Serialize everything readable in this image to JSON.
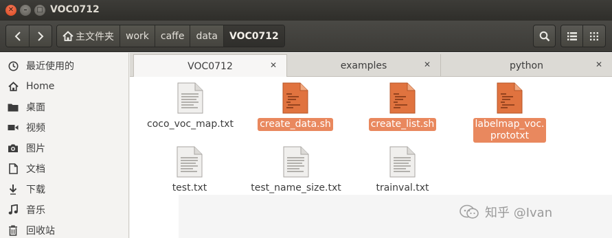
{
  "window": {
    "title": "VOC0712"
  },
  "toolbar": {
    "back_icon": "chevron-left-icon",
    "forward_icon": "chevron-right-icon",
    "breadcrumbs": [
      "主文件夹",
      "work",
      "caffe",
      "data",
      "VOC0712"
    ]
  },
  "sidebar": {
    "items": [
      {
        "label": "最近使用的",
        "icon": "clock-icon"
      },
      {
        "label": "Home",
        "icon": "home-icon"
      },
      {
        "label": "桌面",
        "icon": "folder-icon"
      },
      {
        "label": "视频",
        "icon": "video-icon"
      },
      {
        "label": "图片",
        "icon": "camera-icon"
      },
      {
        "label": "文档",
        "icon": "document-icon"
      },
      {
        "label": "下载",
        "icon": "download-icon"
      },
      {
        "label": "音乐",
        "icon": "music-icon"
      },
      {
        "label": "回收站",
        "icon": "trash-icon"
      }
    ]
  },
  "tabs": [
    {
      "label": "VOC0712",
      "active": true
    },
    {
      "label": "examples",
      "active": false
    },
    {
      "label": "python",
      "active": false
    }
  ],
  "files": [
    {
      "name": "coco_voc_map.txt",
      "type": "text",
      "selected": false
    },
    {
      "name": "create_data.sh",
      "type": "script",
      "selected": true
    },
    {
      "name": "create_list.sh",
      "type": "script",
      "selected": true
    },
    {
      "name_line1": "labelmap_voc.",
      "name_line2": "prototxt",
      "type": "script",
      "selected": true
    },
    {
      "name": "test.txt",
      "type": "text",
      "selected": false
    },
    {
      "name": "test_name_size.txt",
      "type": "text",
      "selected": false
    },
    {
      "name": "trainval.txt",
      "type": "text",
      "selected": false
    }
  ],
  "watermark": {
    "text": "知乎 @Ivan"
  },
  "colors": {
    "selection": "#e9885e",
    "script_icon": "#e0733f",
    "titlebar": "#3d3c38"
  }
}
